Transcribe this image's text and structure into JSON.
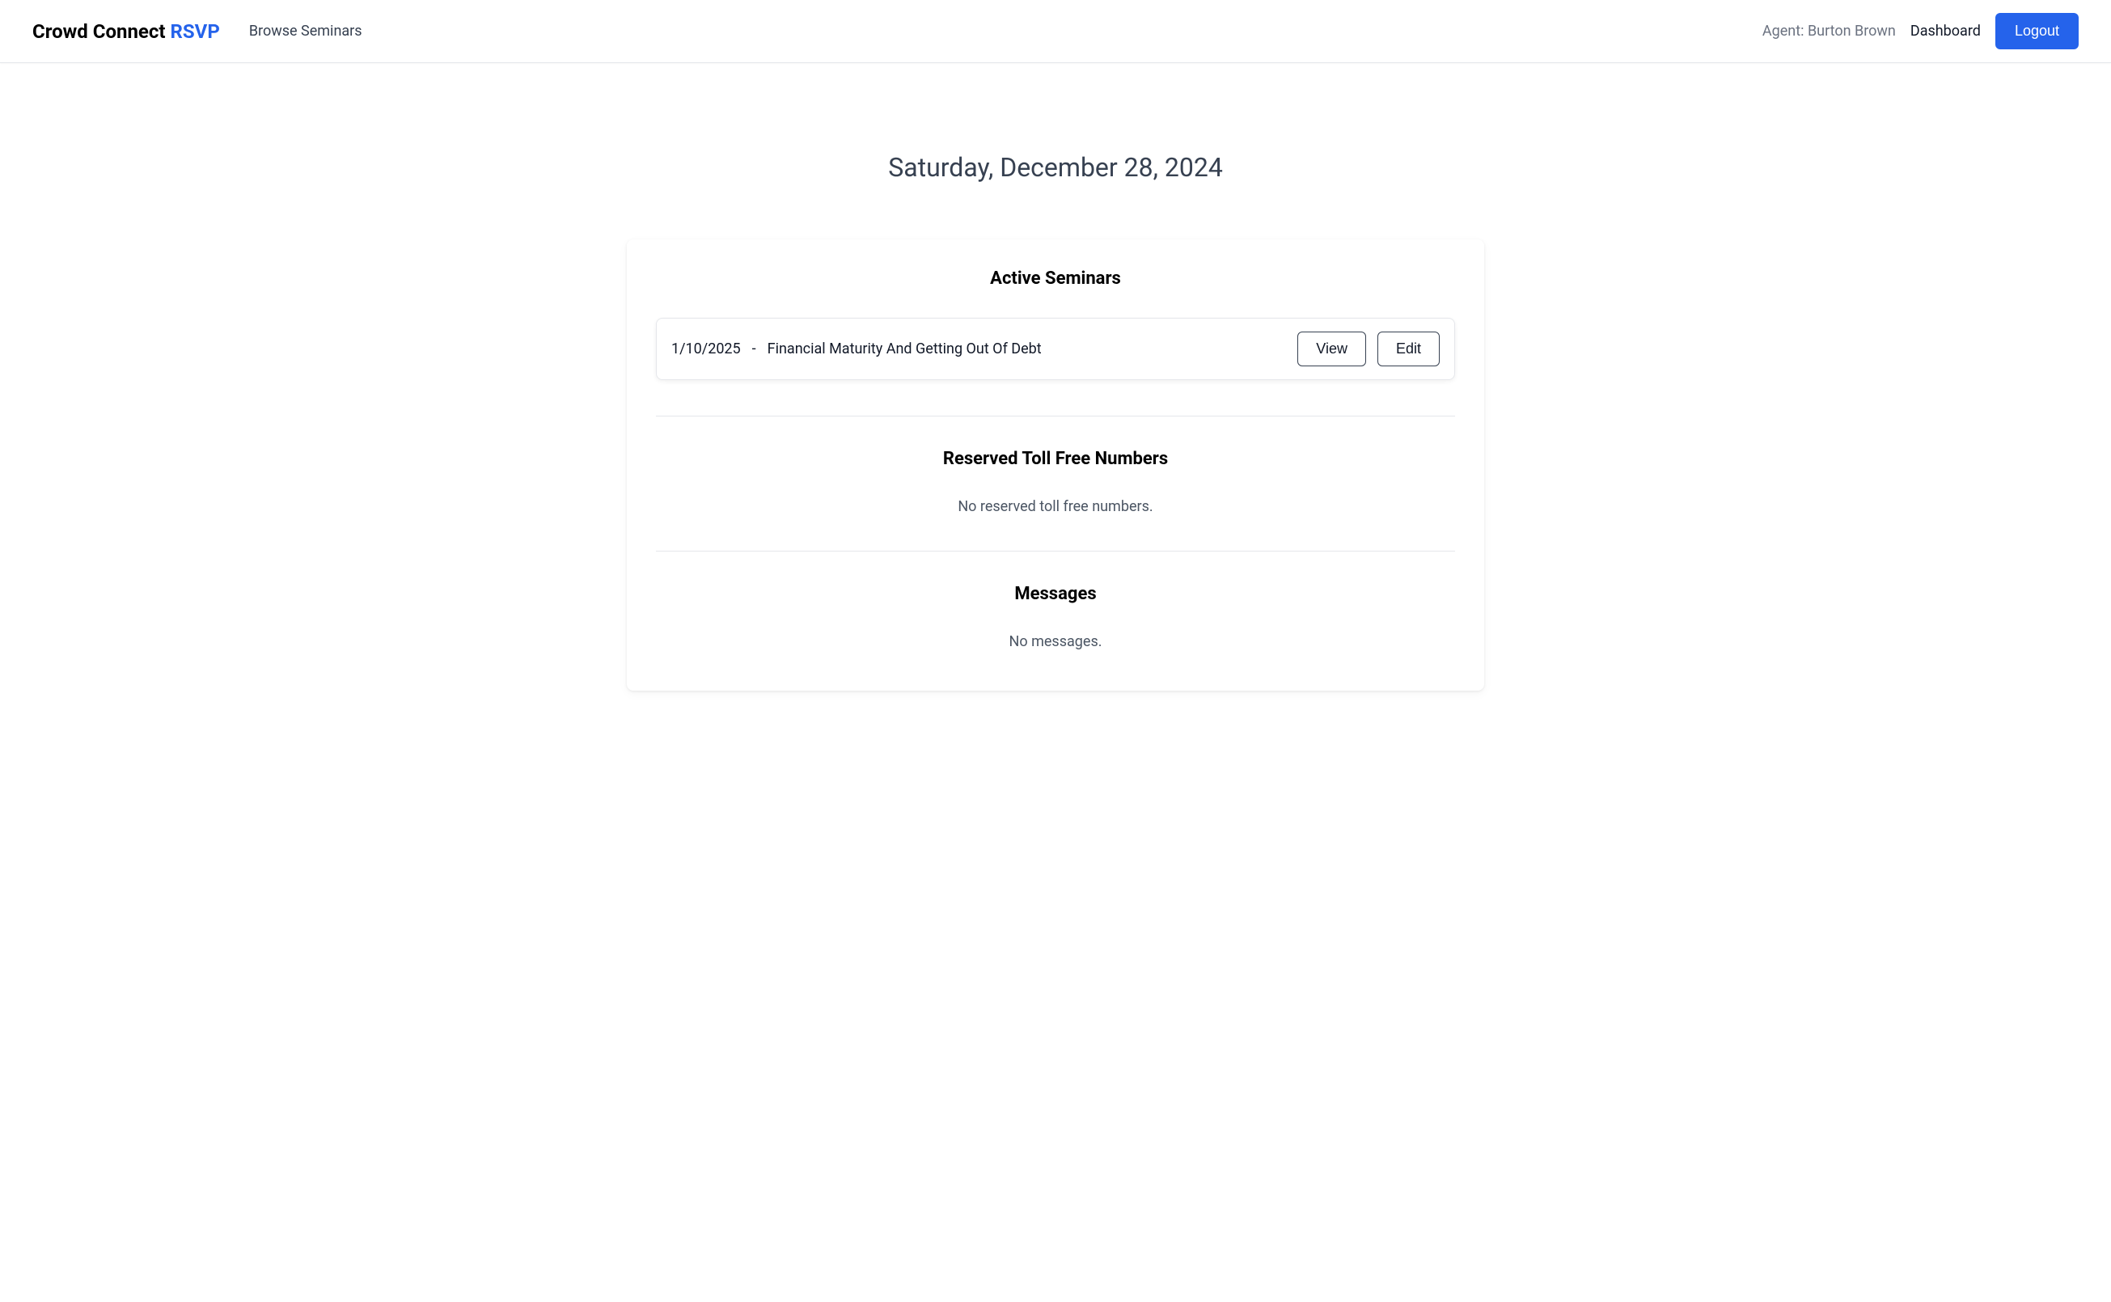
{
  "header": {
    "logo_primary": "Crowd Connect ",
    "logo_accent": "RSVP",
    "browse_link": "Browse Seminars",
    "agent_label": "Agent: Burton Brown",
    "dashboard_link": "Dashboard",
    "logout_label": "Logout"
  },
  "date_heading": "Saturday, December 28, 2024",
  "sections": {
    "active_seminars": {
      "title": "Active Seminars",
      "items": [
        {
          "date": "1/10/2025",
          "separator": "-",
          "title": "Financial Maturity And Getting Out Of Debt",
          "view_label": "View",
          "edit_label": "Edit"
        }
      ]
    },
    "toll_free": {
      "title": "Reserved Toll Free Numbers",
      "empty": "No reserved toll free numbers."
    },
    "messages": {
      "title": "Messages",
      "empty": "No messages."
    }
  }
}
